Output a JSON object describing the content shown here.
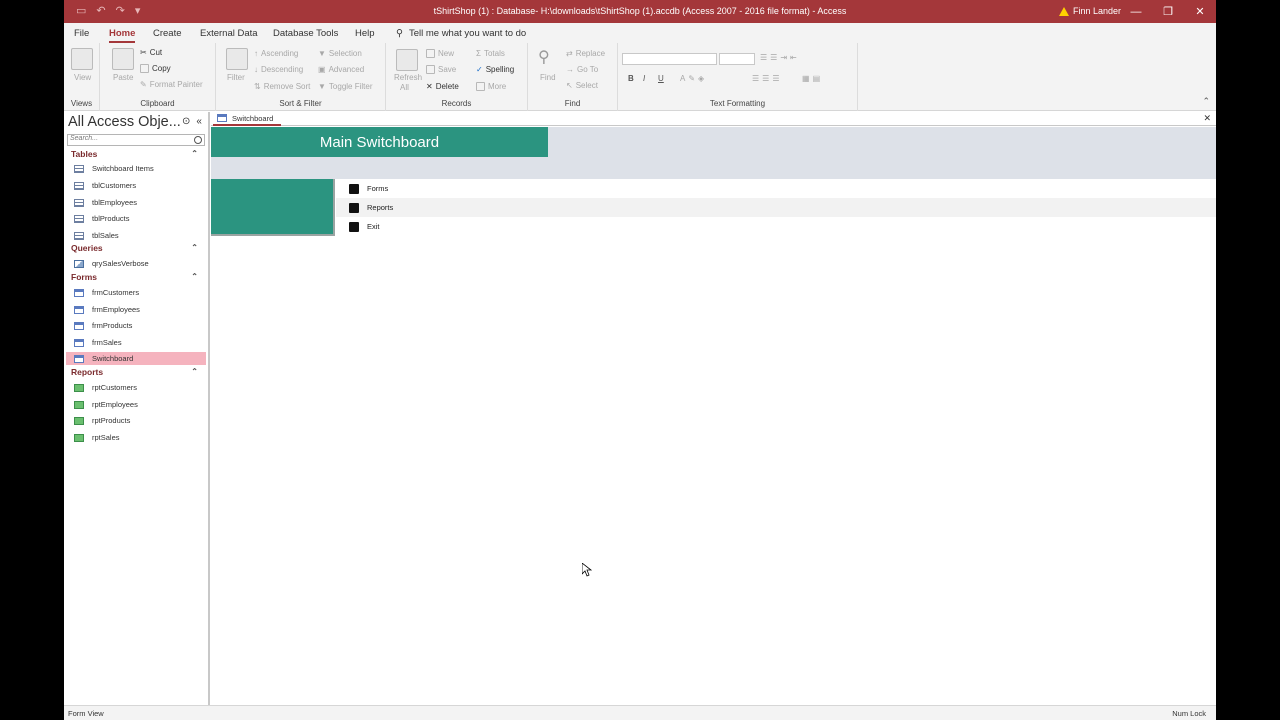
{
  "titlebar": {
    "title": "tShirtShop (1) : Database- H:\\downloads\\tShirtShop (1).accdb (Access 2007 - 2016 file format)  -  Access",
    "user": "Finn Lander",
    "qat_icons": [
      "save-icon",
      "undo-icon",
      "redo-icon",
      "customize-icon"
    ]
  },
  "menu": {
    "tabs": [
      "File",
      "Home",
      "Create",
      "External Data",
      "Database Tools",
      "Help"
    ],
    "active": "Home",
    "tell_me": "Tell me what you want to do"
  },
  "ribbon": {
    "views": {
      "view": "View",
      "label": "Views"
    },
    "clipboard": {
      "paste": "Paste",
      "cut": "Cut",
      "copy": "Copy",
      "format_painter": "Format Painter",
      "label": "Clipboard"
    },
    "sort_filter": {
      "filter": "Filter",
      "ascending": "Ascending",
      "descending": "Descending",
      "remove_sort": "Remove Sort",
      "selection": "Selection",
      "advanced": "Advanced",
      "toggle_filter": "Toggle Filter",
      "label": "Sort & Filter"
    },
    "records": {
      "refresh": "Refresh",
      "all": "All",
      "new": "New",
      "save": "Save",
      "delete": "Delete",
      "totals": "Totals",
      "spelling": "Spelling",
      "more": "More",
      "label": "Records"
    },
    "find": {
      "find": "Find",
      "replace": "Replace",
      "goto": "Go To",
      "select": "Select",
      "label": "Find"
    },
    "text_formatting": {
      "bold": "B",
      "italic": "I",
      "underline": "U",
      "label": "Text Formatting"
    }
  },
  "nav": {
    "header": "All Access Obje...",
    "search_placeholder": "Search...",
    "sections": {
      "tables": {
        "label": "Tables",
        "items": [
          "Switchboard Items",
          "tblCustomers",
          "tblEmployees",
          "tblProducts",
          "tblSales"
        ]
      },
      "queries": {
        "label": "Queries",
        "items": [
          "qrySalesVerbose"
        ]
      },
      "forms": {
        "label": "Forms",
        "items": [
          "frmCustomers",
          "frmEmployees",
          "frmProducts",
          "frmSales",
          "Switchboard"
        ]
      },
      "reports": {
        "label": "Reports",
        "items": [
          "rptCustomers",
          "rptEmployees",
          "rptProducts",
          "rptSales"
        ]
      }
    },
    "selected": "Switchboard"
  },
  "document": {
    "tab": "Switchboard",
    "title": "Main Switchboard",
    "buttons": [
      "Forms",
      "Reports",
      "Exit"
    ],
    "colors": {
      "accent": "#2b9480",
      "header_band": "#dde1e8",
      "title_bar": "#a4373a"
    }
  },
  "status": {
    "left": "Form View",
    "right": "Num Lock"
  }
}
